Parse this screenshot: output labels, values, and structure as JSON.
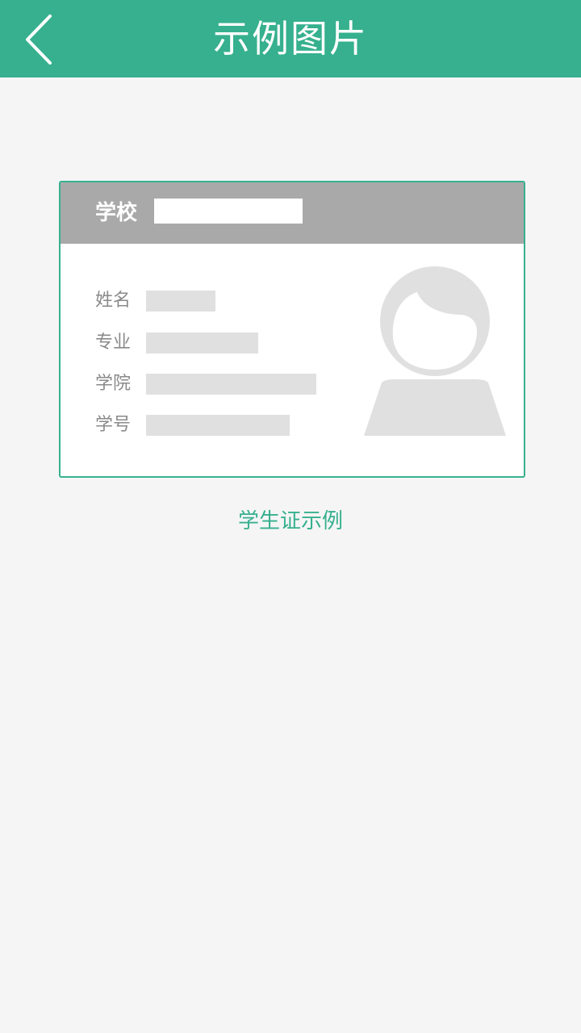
{
  "header": {
    "title": "示例图片",
    "back_icon": "chevron-left-icon",
    "background": "#36b08e"
  },
  "card": {
    "school_label": "学校",
    "fields": [
      {
        "label": "姓名"
      },
      {
        "label": "专业"
      },
      {
        "label": "学院"
      },
      {
        "label": "学号"
      }
    ],
    "avatar_icon": "person-silhouette-icon",
    "border_color": "#36b08e"
  },
  "caption": "学生证示例"
}
